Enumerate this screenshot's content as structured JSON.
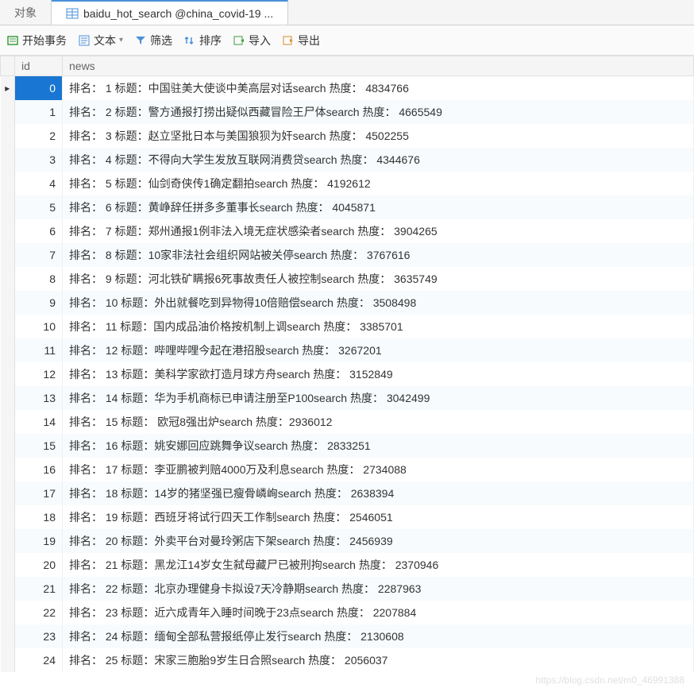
{
  "tabs": {
    "objects": "对象",
    "active": "baidu_hot_search @china_covid-19 ..."
  },
  "toolbar": {
    "begin_transaction": "开始事务",
    "text": "文本",
    "filter": "筛选",
    "sort": "排序",
    "import": "导入",
    "export": "导出"
  },
  "headers": {
    "id": "id",
    "news": "news"
  },
  "rows": [
    {
      "id": "0",
      "news": "排名： 1   标题：中国驻美大使谈中美高层对话search 热度： 4834766"
    },
    {
      "id": "1",
      "news": "排名： 2   标题：警方通报打捞出疑似西藏冒险王尸体search 热度： 4665549"
    },
    {
      "id": "2",
      "news": "排名： 3   标题：赵立坚批日本与美国狼狈为奸search 热度： 4502255"
    },
    {
      "id": "3",
      "news": "排名： 4   标题：不得向大学生发放互联网消费贷search 热度： 4344676"
    },
    {
      "id": "4",
      "news": "排名： 5   标题：仙剑奇侠传1确定翻拍search 热度： 4192612"
    },
    {
      "id": "5",
      "news": "排名： 6   标题：黄峥辞任拼多多董事长search 热度： 4045871"
    },
    {
      "id": "6",
      "news": "排名： 7   标题：郑州通报1例非法入境无症状感染者search 热度： 3904265"
    },
    {
      "id": "7",
      "news": "排名： 8   标题：10家非法社会组织网站被关停search 热度： 3767616"
    },
    {
      "id": "8",
      "news": "排名： 9   标题：河北铁矿瞒报6死事故责任人被控制search 热度： 3635749"
    },
    {
      "id": "9",
      "news": "排名： 10  标题：外出就餐吃到异物得10倍赔偿search 热度： 3508498"
    },
    {
      "id": "10",
      "news": "排名： 11  标题：国内成品油价格按机制上调search 热度： 3385701"
    },
    {
      "id": "11",
      "news": "排名： 12  标题：哔哩哔哩今起在港招股search 热度： 3267201"
    },
    {
      "id": "12",
      "news": "排名： 13  标题：美科学家欲打造月球方舟search 热度： 3152849"
    },
    {
      "id": "13",
      "news": "排名： 14  标题：华为手机商标已申请注册至P100search 热度： 3042499"
    },
    {
      "id": "14",
      "news": "排名： 15  标题：    欧冠8强出炉search          热度：2936012"
    },
    {
      "id": "15",
      "news": "排名： 16  标题：姚安娜回应跳舞争议search 热度： 2833251"
    },
    {
      "id": "16",
      "news": "排名： 17  标题：李亚鹏被判赔4000万及利息search 热度： 2734088"
    },
    {
      "id": "17",
      "news": "排名： 18  标题：14岁的猪坚强已瘦骨嶙峋search 热度： 2638394"
    },
    {
      "id": "18",
      "news": "排名： 19  标题：西班牙将试行四天工作制search 热度： 2546051"
    },
    {
      "id": "19",
      "news": "排名： 20  标题：外卖平台对曼玲粥店下架search 热度： 2456939"
    },
    {
      "id": "20",
      "news": "排名： 21  标题：黑龙江14岁女生弑母藏尸已被刑拘search 热度： 2370946"
    },
    {
      "id": "21",
      "news": "排名： 22  标题：北京办理健身卡拟设7天冷静期search 热度： 2287963"
    },
    {
      "id": "22",
      "news": "排名： 23  标题：近六成青年入睡时间晚于23点search 热度： 2207884"
    },
    {
      "id": "23",
      "news": "排名： 24  标题：缅甸全部私营报纸停止发行search 热度： 2130608"
    },
    {
      "id": "24",
      "news": "排名： 25  标题：宋家三胞胎9岁生日合照search 热度： 2056037"
    }
  ],
  "watermark": "https://blog.csdn.net/m0_46991388"
}
